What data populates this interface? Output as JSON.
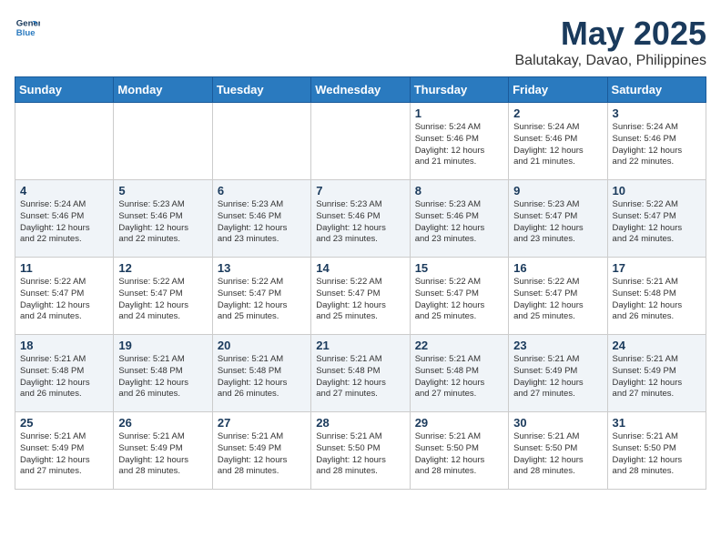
{
  "header": {
    "logo_line1": "General",
    "logo_line2": "Blue",
    "month": "May 2025",
    "location": "Balutakay, Davao, Philippines"
  },
  "weekdays": [
    "Sunday",
    "Monday",
    "Tuesday",
    "Wednesday",
    "Thursday",
    "Friday",
    "Saturday"
  ],
  "weeks": [
    [
      {
        "day": "",
        "info": ""
      },
      {
        "day": "",
        "info": ""
      },
      {
        "day": "",
        "info": ""
      },
      {
        "day": "",
        "info": ""
      },
      {
        "day": "1",
        "info": "Sunrise: 5:24 AM\nSunset: 5:46 PM\nDaylight: 12 hours\nand 21 minutes."
      },
      {
        "day": "2",
        "info": "Sunrise: 5:24 AM\nSunset: 5:46 PM\nDaylight: 12 hours\nand 21 minutes."
      },
      {
        "day": "3",
        "info": "Sunrise: 5:24 AM\nSunset: 5:46 PM\nDaylight: 12 hours\nand 22 minutes."
      }
    ],
    [
      {
        "day": "4",
        "info": "Sunrise: 5:24 AM\nSunset: 5:46 PM\nDaylight: 12 hours\nand 22 minutes."
      },
      {
        "day": "5",
        "info": "Sunrise: 5:23 AM\nSunset: 5:46 PM\nDaylight: 12 hours\nand 22 minutes."
      },
      {
        "day": "6",
        "info": "Sunrise: 5:23 AM\nSunset: 5:46 PM\nDaylight: 12 hours\nand 23 minutes."
      },
      {
        "day": "7",
        "info": "Sunrise: 5:23 AM\nSunset: 5:46 PM\nDaylight: 12 hours\nand 23 minutes."
      },
      {
        "day": "8",
        "info": "Sunrise: 5:23 AM\nSunset: 5:46 PM\nDaylight: 12 hours\nand 23 minutes."
      },
      {
        "day": "9",
        "info": "Sunrise: 5:23 AM\nSunset: 5:47 PM\nDaylight: 12 hours\nand 23 minutes."
      },
      {
        "day": "10",
        "info": "Sunrise: 5:22 AM\nSunset: 5:47 PM\nDaylight: 12 hours\nand 24 minutes."
      }
    ],
    [
      {
        "day": "11",
        "info": "Sunrise: 5:22 AM\nSunset: 5:47 PM\nDaylight: 12 hours\nand 24 minutes."
      },
      {
        "day": "12",
        "info": "Sunrise: 5:22 AM\nSunset: 5:47 PM\nDaylight: 12 hours\nand 24 minutes."
      },
      {
        "day": "13",
        "info": "Sunrise: 5:22 AM\nSunset: 5:47 PM\nDaylight: 12 hours\nand 25 minutes."
      },
      {
        "day": "14",
        "info": "Sunrise: 5:22 AM\nSunset: 5:47 PM\nDaylight: 12 hours\nand 25 minutes."
      },
      {
        "day": "15",
        "info": "Sunrise: 5:22 AM\nSunset: 5:47 PM\nDaylight: 12 hours\nand 25 minutes."
      },
      {
        "day": "16",
        "info": "Sunrise: 5:22 AM\nSunset: 5:47 PM\nDaylight: 12 hours\nand 25 minutes."
      },
      {
        "day": "17",
        "info": "Sunrise: 5:21 AM\nSunset: 5:48 PM\nDaylight: 12 hours\nand 26 minutes."
      }
    ],
    [
      {
        "day": "18",
        "info": "Sunrise: 5:21 AM\nSunset: 5:48 PM\nDaylight: 12 hours\nand 26 minutes."
      },
      {
        "day": "19",
        "info": "Sunrise: 5:21 AM\nSunset: 5:48 PM\nDaylight: 12 hours\nand 26 minutes."
      },
      {
        "day": "20",
        "info": "Sunrise: 5:21 AM\nSunset: 5:48 PM\nDaylight: 12 hours\nand 26 minutes."
      },
      {
        "day": "21",
        "info": "Sunrise: 5:21 AM\nSunset: 5:48 PM\nDaylight: 12 hours\nand 27 minutes."
      },
      {
        "day": "22",
        "info": "Sunrise: 5:21 AM\nSunset: 5:48 PM\nDaylight: 12 hours\nand 27 minutes."
      },
      {
        "day": "23",
        "info": "Sunrise: 5:21 AM\nSunset: 5:49 PM\nDaylight: 12 hours\nand 27 minutes."
      },
      {
        "day": "24",
        "info": "Sunrise: 5:21 AM\nSunset: 5:49 PM\nDaylight: 12 hours\nand 27 minutes."
      }
    ],
    [
      {
        "day": "25",
        "info": "Sunrise: 5:21 AM\nSunset: 5:49 PM\nDaylight: 12 hours\nand 27 minutes."
      },
      {
        "day": "26",
        "info": "Sunrise: 5:21 AM\nSunset: 5:49 PM\nDaylight: 12 hours\nand 28 minutes."
      },
      {
        "day": "27",
        "info": "Sunrise: 5:21 AM\nSunset: 5:49 PM\nDaylight: 12 hours\nand 28 minutes."
      },
      {
        "day": "28",
        "info": "Sunrise: 5:21 AM\nSunset: 5:50 PM\nDaylight: 12 hours\nand 28 minutes."
      },
      {
        "day": "29",
        "info": "Sunrise: 5:21 AM\nSunset: 5:50 PM\nDaylight: 12 hours\nand 28 minutes."
      },
      {
        "day": "30",
        "info": "Sunrise: 5:21 AM\nSunset: 5:50 PM\nDaylight: 12 hours\nand 28 minutes."
      },
      {
        "day": "31",
        "info": "Sunrise: 5:21 AM\nSunset: 5:50 PM\nDaylight: 12 hours\nand 28 minutes."
      }
    ]
  ]
}
